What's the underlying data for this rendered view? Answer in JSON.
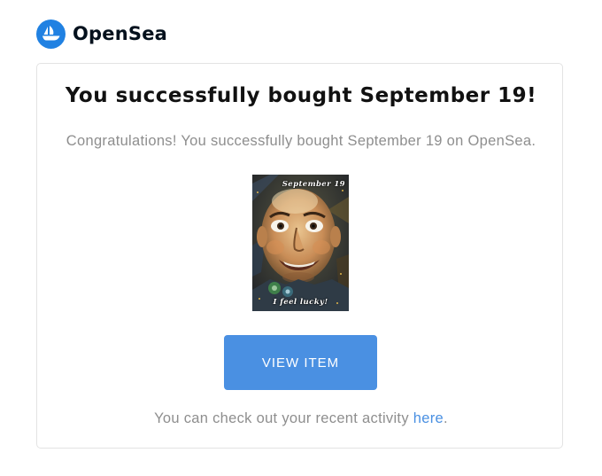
{
  "brand": {
    "name": "OpenSea",
    "logo_icon": "opensea-boat-icon",
    "color": "#2081E2"
  },
  "email": {
    "headline": "You successfully bought September 19!",
    "message": "Congratulations! You successfully bought September 19 on OpenSea.",
    "nft": {
      "caption_top": "September 19",
      "caption_bottom": "I feel lucky!"
    },
    "view_button_label": "VIEW ITEM",
    "footer": {
      "prefix": "You can check out your recent activity ",
      "link_label": "here",
      "suffix": "."
    }
  },
  "colors": {
    "accent": "#4A90E2",
    "muted_text": "#8e8e8e",
    "heading_text": "#111111"
  }
}
